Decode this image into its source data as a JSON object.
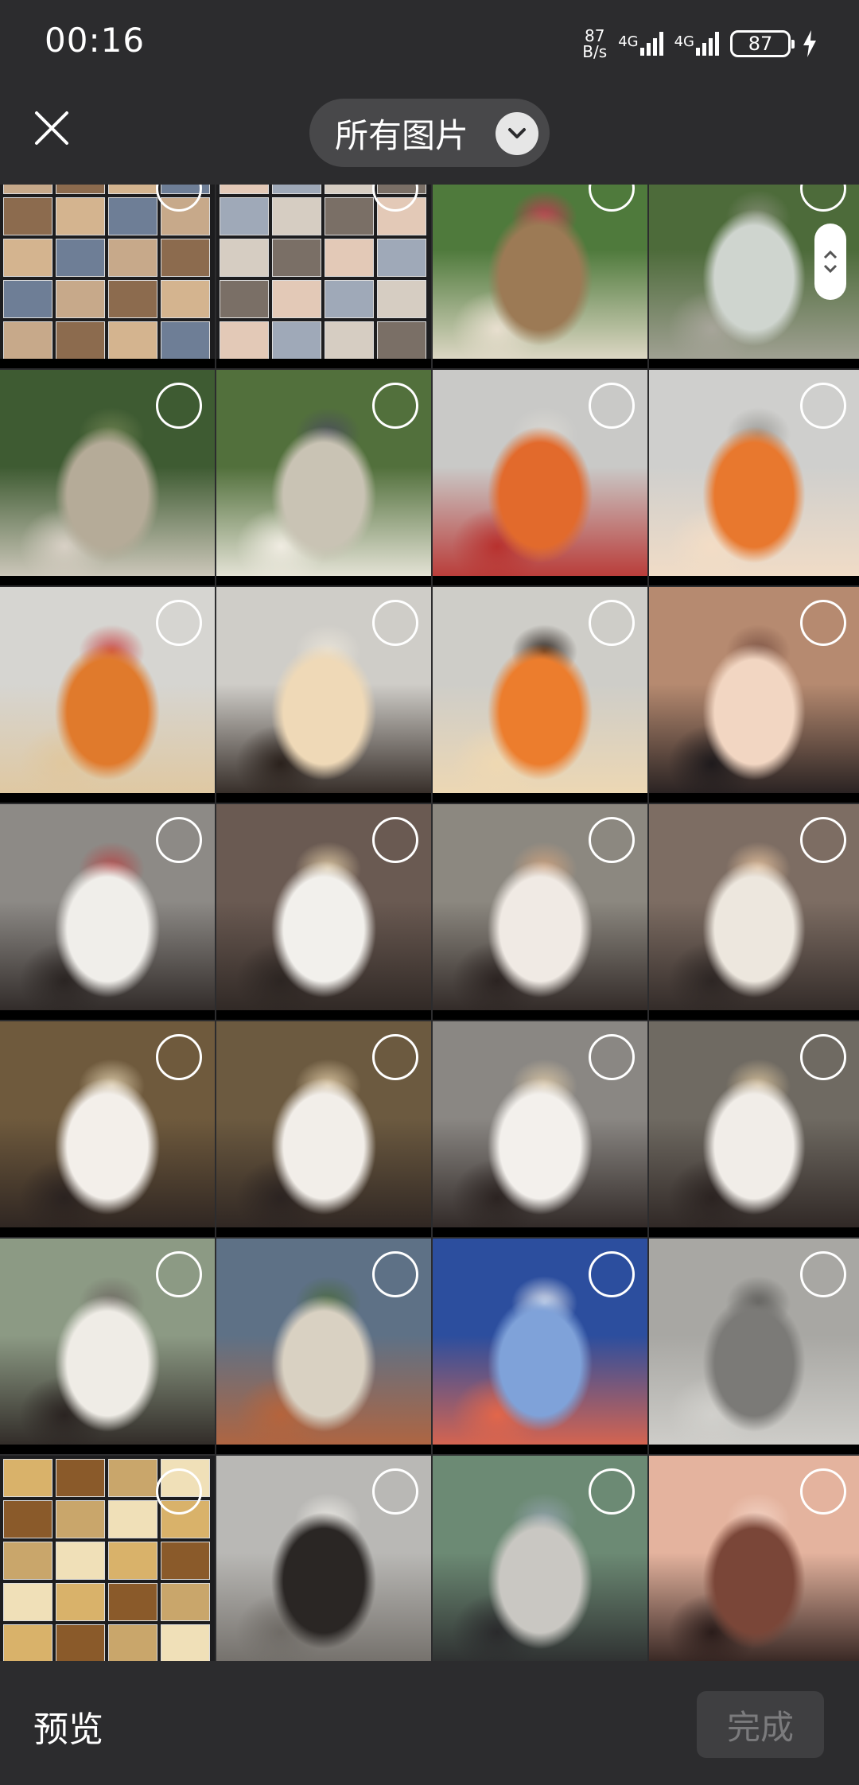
{
  "status_bar": {
    "time": "00:16",
    "net_speed_value": "87",
    "net_speed_unit": "B/s",
    "sim1_label": "4G",
    "sim2_label": "4G",
    "battery_level": "87"
  },
  "header": {
    "album_title": "所有图片",
    "close_icon": "close-icon",
    "dropdown_icon": "chevron-down-icon"
  },
  "grid": {
    "columns": 4,
    "photos": [
      {
        "kind": "collage",
        "colors": [
          "#c7a98a",
          "#8c6b4e",
          "#d4b48f",
          "#6e7e96"
        ]
      },
      {
        "kind": "collage",
        "colors": [
          "#e3c9b7",
          "#9fa9b8",
          "#d6cdc2",
          "#7a6f66"
        ]
      },
      {
        "kind": "photo",
        "colors": [
          "#4f7a3c",
          "#9c7a55",
          "#e8dfcf",
          "#c23a52"
        ]
      },
      {
        "kind": "photo",
        "colors": [
          "#4d6b3a",
          "#cfd5cf",
          "#a7a59a",
          "#7f8a70"
        ]
      },
      {
        "kind": "photo",
        "colors": [
          "#3e5b32",
          "#b5ab98",
          "#d8d0c5",
          "#6a7e4e"
        ]
      },
      {
        "kind": "photo",
        "colors": [
          "#52703c",
          "#c9c3b4",
          "#f0ece2",
          "#4b4f5a"
        ]
      },
      {
        "kind": "photo",
        "colors": [
          "#c9c9c7",
          "#e26a2c",
          "#b8312e",
          "#d9d7d2"
        ]
      },
      {
        "kind": "photo",
        "colors": [
          "#cfcfcd",
          "#e8782e",
          "#f3ddc6",
          "#9d9c98"
        ]
      },
      {
        "kind": "photo",
        "colors": [
          "#d6d5d1",
          "#e07a2c",
          "#e0c79e",
          "#c94a4a"
        ]
      },
      {
        "kind": "photo",
        "colors": [
          "#cfcdc8",
          "#efd9b7",
          "#2a211c",
          "#e7e2d7"
        ]
      },
      {
        "kind": "photo",
        "colors": [
          "#cecdc8",
          "#ec7d2d",
          "#efd8b2",
          "#2b221d"
        ]
      },
      {
        "kind": "photo",
        "colors": [
          "#b68a70",
          "#f2d6c2",
          "#1e1a1c",
          "#7d5445"
        ]
      },
      {
        "kind": "photo",
        "colors": [
          "#8d8a86",
          "#f0eeea",
          "#2a2422",
          "#b24a4a"
        ]
      },
      {
        "kind": "photo",
        "colors": [
          "#6a5a52",
          "#f2f0ec",
          "#2c2522",
          "#d8c39f"
        ]
      },
      {
        "kind": "photo",
        "colors": [
          "#8c8880",
          "#f0eae4",
          "#2b2321",
          "#c9a07e"
        ]
      },
      {
        "kind": "photo",
        "colors": [
          "#7d6d63",
          "#ede7de",
          "#2d2624",
          "#ddbb99"
        ]
      },
      {
        "kind": "photo",
        "colors": [
          "#6f5a3d",
          "#f3efea",
          "#2a2220",
          "#d9c8a7"
        ]
      },
      {
        "kind": "photo",
        "colors": [
          "#6c5a40",
          "#f2eee9",
          "#2b2321",
          "#d9c4a0"
        ]
      },
      {
        "kind": "photo",
        "colors": [
          "#8a8783",
          "#f3f0ec",
          "#2b2321",
          "#d6c3a3"
        ]
      },
      {
        "kind": "photo",
        "colors": [
          "#6f6a62",
          "#f1ede8",
          "#2b2321",
          "#d1bc98"
        ]
      },
      {
        "kind": "photo",
        "colors": [
          "#8c9a84",
          "#efece6",
          "#2a2321",
          "#6f6a63"
        ]
      },
      {
        "kind": "photo",
        "colors": [
          "#5e7186",
          "#d9d1c2",
          "#b5643c",
          "#4c6a42"
        ]
      },
      {
        "kind": "photo",
        "colors": [
          "#2c4e9e",
          "#7fa2d9",
          "#e2664a",
          "#dfe4ee"
        ]
      },
      {
        "kind": "photo",
        "colors": [
          "#a8a7a3",
          "#7b7a77",
          "#d1d0cc",
          "#5c5b58"
        ]
      },
      {
        "kind": "collage",
        "colors": [
          "#d9b26a",
          "#8a5a2a",
          "#c9a66b",
          "#f0e0b8"
        ]
      },
      {
        "kind": "photo",
        "colors": [
          "#b9b8b5",
          "#2a2624",
          "#6f6b66",
          "#e9e7e2"
        ]
      },
      {
        "kind": "photo",
        "colors": [
          "#6c8a74",
          "#c9c7c2",
          "#2a2a2c",
          "#8fa0a8"
        ]
      },
      {
        "kind": "photo",
        "colors": [
          "#e4b39e",
          "#7a4638",
          "#2a1c1a",
          "#f2d1c2"
        ]
      }
    ]
  },
  "bottom_bar": {
    "preview_label": "预览",
    "done_label": "完成"
  }
}
